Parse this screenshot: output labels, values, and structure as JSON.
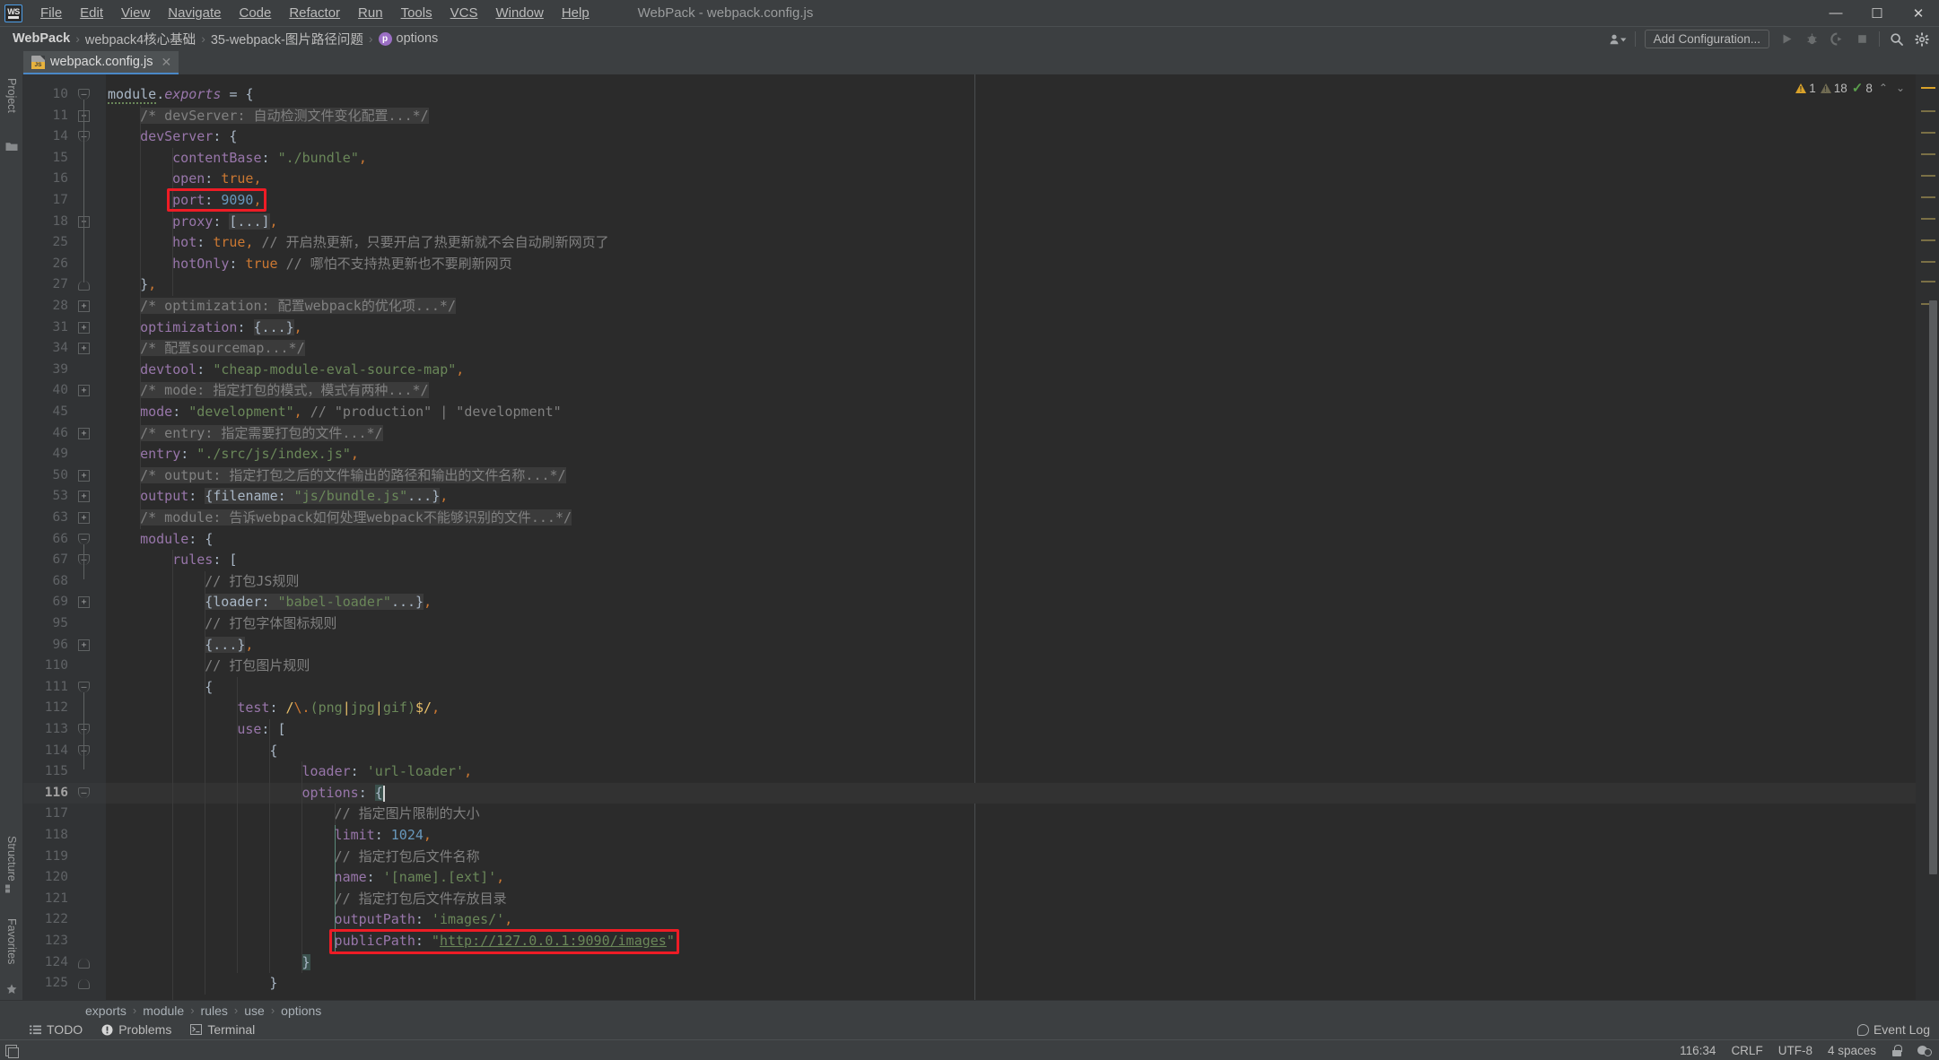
{
  "window": {
    "title": "WebPack - webpack.config.js",
    "logo_text": "WS",
    "minimize": "—",
    "maximize": "☐",
    "close": "✕"
  },
  "menu": [
    {
      "label": "File"
    },
    {
      "label": "Edit"
    },
    {
      "label": "View"
    },
    {
      "label": "Navigate"
    },
    {
      "label": "Code"
    },
    {
      "label": "Refactor"
    },
    {
      "label": "Run"
    },
    {
      "label": "Tools"
    },
    {
      "label": "VCS"
    },
    {
      "label": "Window"
    },
    {
      "label": "Help"
    }
  ],
  "breadcrumb_top": {
    "items": [
      "WebPack",
      "webpack4核心基础",
      "35-webpack-图片路径问题",
      "options"
    ],
    "separator": "›",
    "last_icon_letter": "p"
  },
  "toolbar": {
    "add_configuration": "Add Configuration...",
    "icons": [
      "user-chevron-icon",
      "run-icon",
      "debug-icon",
      "coverage-icon",
      "stop-icon",
      "search-icon",
      "settings-icon"
    ]
  },
  "tabs": [
    {
      "label": "webpack.config.js",
      "icon": "js-file-icon",
      "active": true,
      "close": "✕"
    }
  ],
  "left_strip": {
    "project": "Project",
    "structure": "Structure",
    "favorites": "Favorites"
  },
  "inspection": {
    "warnings": "1",
    "weak_warnings": "18",
    "ok_count": "8",
    "up_arrow": "⌃",
    "down_arrow": "⌄"
  },
  "editor": {
    "current_line_number": 116,
    "margin_guide_column": 120,
    "lines": [
      {
        "n": "10",
        "fold": "minus",
        "html": "<span class='plain squig'>module</span><span class='punc'>.</span><span class='prop ital'>exports</span> <span class='punc'>=</span> <span class='punc'>{</span>",
        "indent": 0
      },
      {
        "n": "11",
        "fold": "plus",
        "html": "<span class='cmtblk'>/* devServer: 自动检测文件变化配置...*/</span>",
        "indent": 1
      },
      {
        "n": "14",
        "fold": "minus",
        "html": "<span class='prop'>devServer</span><span class='punc'>: {</span>",
        "indent": 1
      },
      {
        "n": "15",
        "fold": "",
        "html": "<span class='prop'>contentBase</span><span class='punc'>: </span><span class='str'>\"./bundle\"</span><span class='comma'>,</span>",
        "indent": 2
      },
      {
        "n": "16",
        "fold": "",
        "html": "<span class='prop'>open</span><span class='punc'>: </span><span class='k'>true</span><span class='comma'>,</span>",
        "indent": 2
      },
      {
        "n": "17",
        "fold": "",
        "html": "<span class='prop'>port</span><span class='punc'>: </span><span class='num'>9090</span><span class='comma'>,</span>",
        "indent": 2
      },
      {
        "n": "18",
        "fold": "plus",
        "html": "<span class='prop'>proxy</span><span class='punc'>: </span><span class='fadebg'>[...]</span><span class='comma'>,</span>",
        "indent": 2
      },
      {
        "n": "25",
        "fold": "",
        "html": "<span class='prop'>hot</span><span class='punc'>: </span><span class='k'>true</span><span class='comma'>, </span><span class='cmt'>// 开启热更新，只要开启了热更新就不会自动刷新网页了</span>",
        "indent": 2
      },
      {
        "n": "26",
        "fold": "",
        "html": "<span class='prop'>hotOnly</span><span class='punc'>: </span><span class='k'>true</span> <span class='cmt'>// 哪怕不支持热更新也不要刷新网页</span>",
        "indent": 2
      },
      {
        "n": "27",
        "fold": "endm",
        "html": "<span class='punc'>}</span><span class='comma'>,</span>",
        "indent": 1
      },
      {
        "n": "28",
        "fold": "plus",
        "html": "<span class='cmtblk'>/* optimization: 配置webpack的优化项...*/</span>",
        "indent": 1
      },
      {
        "n": "31",
        "fold": "plus",
        "html": "<span class='prop'>optimization</span><span class='punc'>: </span><span class='fadebg'>{...}</span><span class='comma'>,</span>",
        "indent": 1
      },
      {
        "n": "34",
        "fold": "plus",
        "html": "<span class='cmtblk'>/* 配置sourcemap...*/</span>",
        "indent": 1
      },
      {
        "n": "39",
        "fold": "",
        "html": "<span class='prop'>devtool</span><span class='punc'>: </span><span class='str'>\"cheap-module-eval-source-map\"</span><span class='comma'>,</span>",
        "indent": 1
      },
      {
        "n": "40",
        "fold": "plus",
        "html": "<span class='cmtblk'>/* mode: 指定打包的模式，模式有两种...*/</span>",
        "indent": 1
      },
      {
        "n": "45",
        "fold": "",
        "html": "<span class='prop'>mode</span><span class='punc'>: </span><span class='str'>\"development\"</span><span class='comma'>, </span><span class='cmt'>// \"production\" | \"development\"</span>",
        "indent": 1
      },
      {
        "n": "46",
        "fold": "plus",
        "html": "<span class='cmtblk'>/* entry: 指定需要打包的文件...*/</span>",
        "indent": 1
      },
      {
        "n": "49",
        "fold": "",
        "html": "<span class='prop'>entry</span><span class='punc'>: </span><span class='str'>\"./src/js/index.js\"</span><span class='comma'>,</span>",
        "indent": 1
      },
      {
        "n": "50",
        "fold": "plus",
        "html": "<span class='cmtblk'>/* output: 指定打包之后的文件输出的路径和输出的文件名称...*/</span>",
        "indent": 1
      },
      {
        "n": "53",
        "fold": "plus",
        "html": "<span class='prop'>output</span><span class='punc'>: </span><span class='fadebg'>{filename: <span class='str'>\"js/bundle.js\"</span>...}</span><span class='comma'>,</span>",
        "indent": 1
      },
      {
        "n": "63",
        "fold": "plus",
        "html": "<span class='cmtblk'>/* module: 告诉webpack如何处理webpack不能够识别的文件...*/</span>",
        "indent": 1
      },
      {
        "n": "66",
        "fold": "minus",
        "html": "<span class='prop'>module</span><span class='punc'>: {</span>",
        "indent": 1
      },
      {
        "n": "67",
        "fold": "minus",
        "html": "<span class='prop'>rules</span><span class='punc'>: [</span>",
        "indent": 2
      },
      {
        "n": "68",
        "fold": "",
        "html": "<span class='cmt'>// 打包JS规则</span>",
        "indent": 3
      },
      {
        "n": "69",
        "fold": "plus",
        "html": "<span class='fadebg'>{loader: <span class='str'>\"babel-loader\"</span>...}</span><span class='comma'>,</span>",
        "indent": 3
      },
      {
        "n": "95",
        "fold": "",
        "html": "<span class='cmt'>// 打包字体图标规则</span>",
        "indent": 3
      },
      {
        "n": "96",
        "fold": "plus",
        "html": "<span class='fadebg'>{...}</span><span class='comma'>,</span>",
        "indent": 3
      },
      {
        "n": "110",
        "fold": "",
        "html": "<span class='cmt'>// 打包图片规则</span>",
        "indent": 3
      },
      {
        "n": "111",
        "fold": "minus",
        "html": "<span class='punc'>{</span>",
        "indent": 3
      },
      {
        "n": "112",
        "fold": "",
        "html": "<span class='prop'>test</span><span class='punc'>: </span><span class='rex3'>/</span><span class='rex1'>\\.</span><span class='rex2'>(</span><span class='rex2'>png</span><span class='rex3'>|</span><span class='rex2'>jpg</span><span class='rex3'>|</span><span class='rex2'>gif</span><span class='rex2'>)</span><span class='rex3'>$</span><span class='rex3'>/</span><span class='comma'>,</span>",
        "indent": 4
      },
      {
        "n": "113",
        "fold": "minus",
        "html": "<span class='prop'>use</span><span class='punc'>: [</span>",
        "indent": 4
      },
      {
        "n": "114",
        "fold": "minus",
        "html": "<span class='punc'>{</span>",
        "indent": 5
      },
      {
        "n": "115",
        "fold": "",
        "html": "<span class='prop'>loader</span><span class='punc'>: </span><span class='str'>'url-loader'</span><span class='comma'>,</span>",
        "indent": 6
      },
      {
        "n": "116",
        "fold": "minus",
        "html": "<span class='prop'>options</span><span class='punc'>: </span><span class='brace-hi'>{</span>",
        "indent": 6
      },
      {
        "n": "117",
        "fold": "",
        "html": "<span class='cmt'>// 指定图片限制的大小</span>",
        "indent": 7
      },
      {
        "n": "118",
        "fold": "",
        "html": "<span class='prop'>limit</span><span class='punc'>: </span><span class='num'>1024</span><span class='comma'>,</span>",
        "indent": 7
      },
      {
        "n": "119",
        "fold": "",
        "html": "<span class='cmt'>// 指定打包后文件名称</span>",
        "indent": 7
      },
      {
        "n": "120",
        "fold": "",
        "html": "<span class='prop'>name</span><span class='punc'>: </span><span class='str'>'[name].[ext]'</span><span class='comma'>,</span>",
        "indent": 7
      },
      {
        "n": "121",
        "fold": "",
        "html": "<span class='cmt'>// 指定打包后文件存放目录</span>",
        "indent": 7
      },
      {
        "n": "122",
        "fold": "",
        "html": "<span class='prop'>outputPath</span><span class='punc'>: </span><span class='str'>'images/'</span><span class='comma'>,</span>",
        "indent": 7
      },
      {
        "n": "123",
        "fold": "",
        "html": "<span class='prop'>publicPath</span><span class='punc'>: </span><span class='str'>\"</span><span class='link'>http://127.0.0.1:9090/images</span><span class='str'>\"</span>",
        "indent": 7
      },
      {
        "n": "124",
        "fold": "endm",
        "html": "<span class='brace-hi'>}</span>",
        "indent": 6
      },
      {
        "n": "125",
        "fold": "endm",
        "html": "<span class='punc'>}</span>",
        "indent": 5
      }
    ],
    "highlights": [
      {
        "label": "port-9090-highlight",
        "line": "17"
      },
      {
        "label": "publicPath-highlight",
        "line": "123"
      }
    ]
  },
  "breadcrumb_bottom": {
    "items": [
      "exports",
      "module",
      "rules",
      "use",
      "options"
    ],
    "separator": "›"
  },
  "toolwindows": [
    {
      "label": "TODO",
      "icon": "list-icon"
    },
    {
      "label": "Problems",
      "icon": "problems-icon"
    },
    {
      "label": "Terminal",
      "icon": "terminal-icon"
    }
  ],
  "event_log": "Event Log",
  "status": {
    "caret_position": "116:34",
    "line_separator": "CRLF",
    "encoding": "UTF-8",
    "indent": "4 spaces",
    "lock_icon": "unlocked-icon",
    "hector_icon": "inspections-icon"
  },
  "colors": {
    "chrome": "#3c3f41",
    "editor_bg": "#2b2b2b",
    "gutter_bg": "#313335",
    "accent_blue": "#4a88c7",
    "annotation_red": "#ee1c25",
    "string_green": "#6a8759",
    "keyword_orange": "#cc7832",
    "property_purple": "#9876aa",
    "number_blue": "#6897bb",
    "comment_grey": "#808080"
  }
}
